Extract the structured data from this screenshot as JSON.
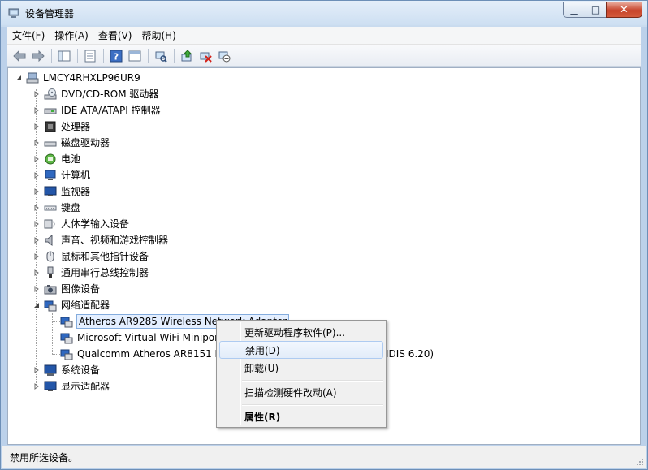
{
  "window": {
    "title": "设备管理器"
  },
  "menubar": {
    "items": [
      "文件(F)",
      "操作(A)",
      "查看(V)",
      "帮助(H)"
    ]
  },
  "toolbar": {
    "buttons": [
      "back-icon",
      "forward-icon",
      "show-hide-tree-icon",
      "properties-icon",
      "help-icon",
      "view-icon",
      "scan-hardware-icon",
      "update-driver-icon",
      "uninstall-icon",
      "disable-icon"
    ]
  },
  "tree": {
    "root": "LMCY4RHXLP96UR9",
    "categories": [
      "DVD/CD-ROM 驱动器",
      "IDE ATA/ATAPI 控制器",
      "处理器",
      "磁盘驱动器",
      "电池",
      "计算机",
      "监视器",
      "键盘",
      "人体学输入设备",
      "声音、视频和游戏控制器",
      "鼠标和其他指针设备",
      "通用串行总线控制器",
      "图像设备",
      "网络适配器"
    ],
    "network_adapters": [
      "Atheros AR9285 Wireless Network Adapter",
      "Microsoft Virtual WiFi Miniport Adapter",
      "Qualcomm Atheros AR8151 PCI-E Gigabit Ethernet Controller (NDIS 6.20)"
    ],
    "after": [
      "系统设备",
      "显示适配器"
    ]
  },
  "context_menu": {
    "update_driver": "更新驱动程序软件(P)...",
    "disable": "禁用(D)",
    "uninstall": "卸载(U)",
    "scan": "扫描检测硬件改动(A)",
    "properties": "属性(R)"
  },
  "status": {
    "text": "禁用所选设备。"
  }
}
